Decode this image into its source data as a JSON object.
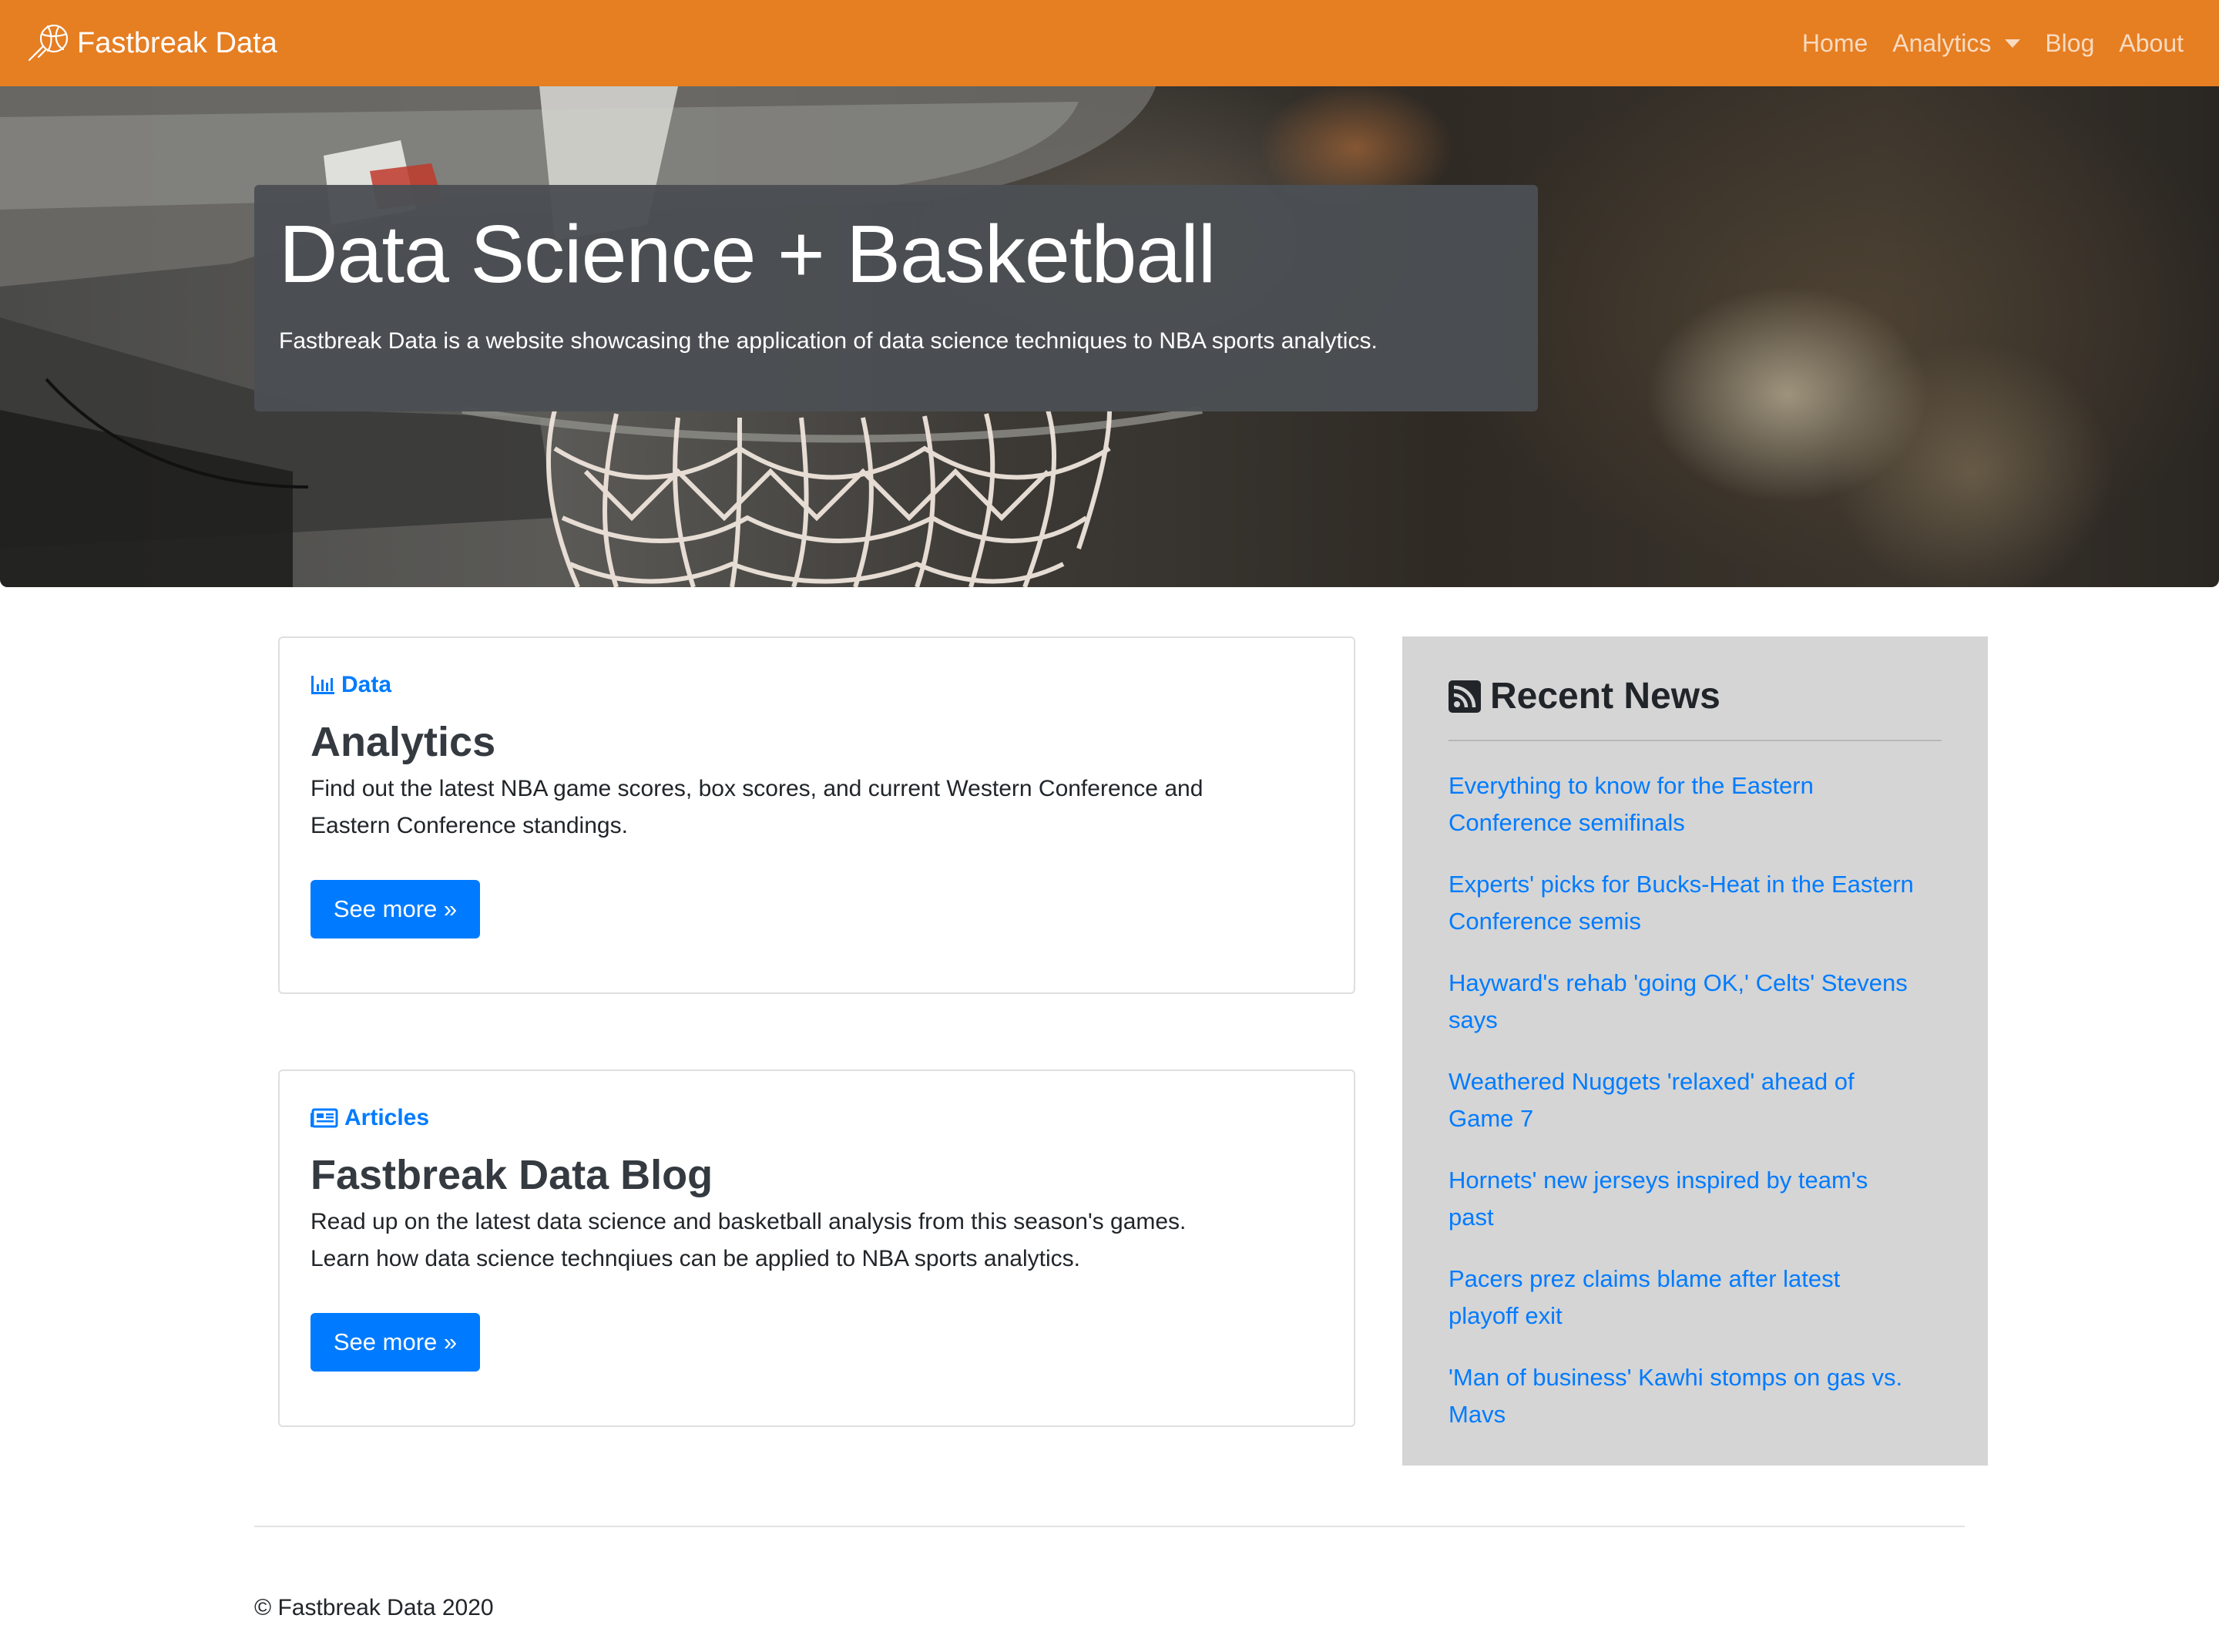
{
  "brand": {
    "name": "Fastbreak Data",
    "icon": "basketball-icon"
  },
  "nav": {
    "items": [
      {
        "label": "Home"
      },
      {
        "label": "Analytics",
        "has_dropdown": true
      },
      {
        "label": "Blog"
      },
      {
        "label": "About"
      }
    ]
  },
  "hero": {
    "title": "Data Science + Basketball",
    "lead": "Fastbreak Data is a website showcasing the application of data science techniques to NBA sports analytics."
  },
  "cards": [
    {
      "eyebrow": "Data",
      "eyebrow_icon": "bar-chart-icon",
      "title": "Analytics",
      "text_lines": [
        "Find out the latest NBA game scores, box scores, and current Western Conference and",
        "Eastern Conference standings."
      ],
      "button": "See more »"
    },
    {
      "eyebrow": "Articles",
      "eyebrow_icon": "newspaper-icon",
      "title": "Fastbreak Data Blog",
      "text_lines": [
        "Read up on the latest data science and basketball analysis from this season's games.",
        "Learn how data science technqiues can be applied to NBA sports analytics."
      ],
      "button": "See more »"
    }
  ],
  "sidebar": {
    "title": "Recent News",
    "icon": "rss-icon",
    "news": [
      {
        "line1": "Everything to know for the Eastern",
        "line2": "Conference semifinals"
      },
      {
        "line1": "Experts' picks for Bucks-Heat in the Eastern",
        "line2": "Conference semis"
      },
      {
        "line1": "Hayward's rehab 'going OK,' Celts' Stevens",
        "line2": "says"
      },
      {
        "line1": "Weathered Nuggets 'relaxed' ahead of",
        "line2": "Game 7"
      },
      {
        "line1": "Hornets' new jerseys inspired by team's",
        "line2": "past"
      },
      {
        "line1": "Pacers prez claims blame after latest",
        "line2": "playoff exit"
      },
      {
        "line1": "'Man of business' Kawhi stomps on gas vs.",
        "line2": "Mavs"
      }
    ]
  },
  "footer": {
    "text": "© Fastbreak Data 2020"
  },
  "colors": {
    "navbar": "#e67e22",
    "link": "#007bff",
    "sidebar_bg": "#d5d5d5",
    "hero_box": "#4b4f53"
  }
}
